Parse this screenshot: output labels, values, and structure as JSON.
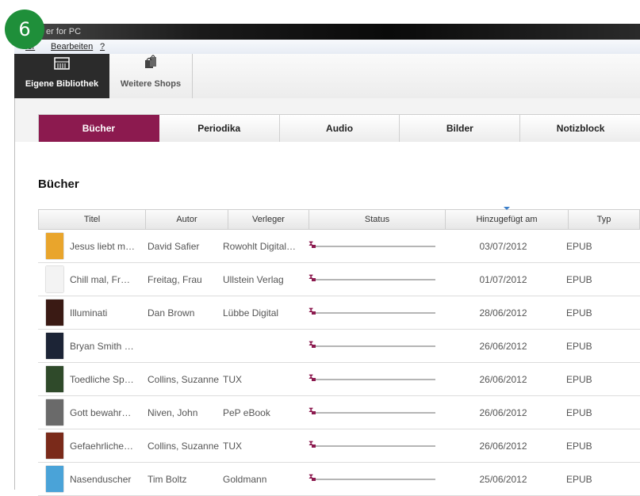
{
  "step_badge": "6",
  "window": {
    "title": "er for PC"
  },
  "menu": {
    "items": [
      "ler",
      "Bearbeiten",
      "?"
    ]
  },
  "toolbar": {
    "library_label": "Eigene Bibliothek",
    "shops_label": "Weitere Shops",
    "library_icon": "library-shelf-icon",
    "shops_icon": "shopping-bags-icon"
  },
  "tabs": [
    {
      "label": "Bücher",
      "active": true
    },
    {
      "label": "Periodika",
      "active": false
    },
    {
      "label": "Audio",
      "active": false
    },
    {
      "label": "Bilder",
      "active": false
    },
    {
      "label": "Notizblock",
      "active": false
    }
  ],
  "section": {
    "title": "Bücher"
  },
  "table": {
    "headers": [
      "Titel",
      "Autor",
      "Verleger",
      "Status",
      "Hinzugefügt am",
      "Typ"
    ],
    "sorted_column": "Hinzugefügt am",
    "rows": [
      {
        "title": "Jesus liebt m…",
        "author": "David Safier",
        "publisher": "Rowohlt Digital…",
        "progress": 0.03,
        "added": "03/07/2012",
        "type": "EPUB",
        "cover": "#e9a52c"
      },
      {
        "title": "Chill mal, Fr…",
        "author": "Freitag, Frau",
        "publisher": "Ullstein Verlag",
        "progress": 0.03,
        "added": "01/07/2012",
        "type": "EPUB",
        "cover": "#f3f3f3"
      },
      {
        "title": "Illuminati",
        "author": "Dan Brown",
        "publisher": "Lübbe Digital",
        "progress": 0.03,
        "added": "28/06/2012",
        "type": "EPUB",
        "cover": "#3a1a14"
      },
      {
        "title": "Bryan Smith …",
        "author": "",
        "publisher": "",
        "progress": 0.03,
        "added": "26/06/2012",
        "type": "EPUB",
        "cover": "#1c2436"
      },
      {
        "title": "Toedliche Sp…",
        "author": "Collins, Suzanne",
        "publisher": "TUX",
        "progress": 0.03,
        "added": "26/06/2012",
        "type": "EPUB",
        "cover": "#2f4a2a"
      },
      {
        "title": "Gott bewahr…",
        "author": "Niven, John",
        "publisher": "PeP eBook",
        "progress": 0.03,
        "added": "26/06/2012",
        "type": "EPUB",
        "cover": "#6a6a6a"
      },
      {
        "title": "Gefaehrliche…",
        "author": "Collins, Suzanne",
        "publisher": "TUX",
        "progress": 0.03,
        "added": "26/06/2012",
        "type": "EPUB",
        "cover": "#7a2a1a"
      },
      {
        "title": "Nasenduscher",
        "author": "Tim Boltz",
        "publisher": "Goldmann",
        "progress": 0.03,
        "added": "25/06/2012",
        "type": "EPUB",
        "cover": "#4aa3d8"
      }
    ]
  },
  "colors": {
    "accent": "#8c1a4f",
    "badge": "#1f8f3a"
  }
}
